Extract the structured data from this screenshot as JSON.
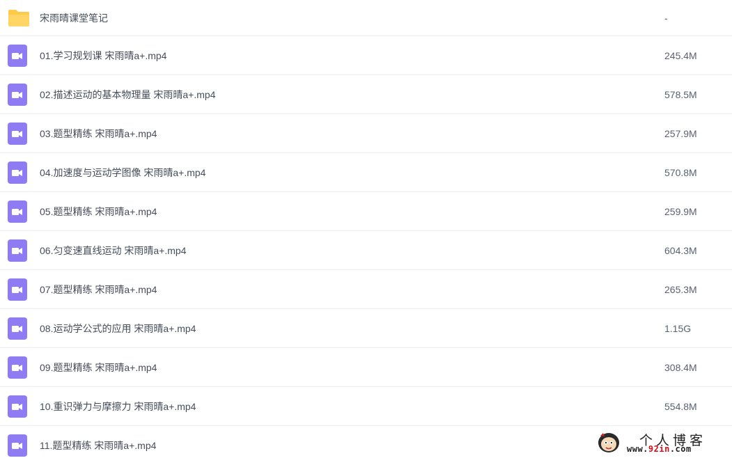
{
  "files": [
    {
      "type": "folder",
      "name": "宋雨晴课堂笔记",
      "size": "-"
    },
    {
      "type": "video",
      "name": "01.学习规划课 宋雨晴a+.mp4",
      "size": "245.4M"
    },
    {
      "type": "video",
      "name": "02.描述运动的基本物理量 宋雨晴a+.mp4",
      "size": "578.5M"
    },
    {
      "type": "video",
      "name": "03.题型精练 宋雨晴a+.mp4",
      "size": "257.9M"
    },
    {
      "type": "video",
      "name": "04.加速度与运动学图像 宋雨晴a+.mp4",
      "size": "570.8M"
    },
    {
      "type": "video",
      "name": "05.题型精练 宋雨晴a+.mp4",
      "size": "259.9M"
    },
    {
      "type": "video",
      "name": "06.匀变速直线运动 宋雨晴a+.mp4",
      "size": "604.3M"
    },
    {
      "type": "video",
      "name": "07.题型精练 宋雨晴a+.mp4",
      "size": "265.3M"
    },
    {
      "type": "video",
      "name": "08.运动学公式的应用 宋雨晴a+.mp4",
      "size": "1.15G"
    },
    {
      "type": "video",
      "name": "09.题型精练 宋雨晴a+.mp4",
      "size": "308.4M"
    },
    {
      "type": "video",
      "name": "10.重识弹力与摩擦力 宋雨晴a+.mp4",
      "size": "554.8M"
    },
    {
      "type": "video",
      "name": "11.题型精练 宋雨晴a+.mp4",
      "size": ""
    }
  ],
  "watermark": {
    "title": "个人博客",
    "url_prefix": "www.",
    "url_accent": "92in",
    "url_suffix": ".com"
  },
  "colors": {
    "folder": "#ffc94a",
    "video": "#8f7cf2",
    "row_border": "#f0f0f2"
  },
  "icons": {
    "folder": "folder-icon",
    "video": "video-file-icon"
  }
}
